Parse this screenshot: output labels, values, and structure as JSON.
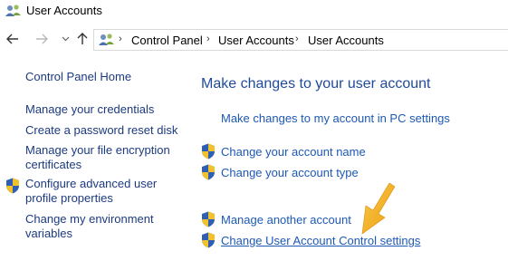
{
  "window": {
    "title": "User Accounts"
  },
  "address_bar": {
    "breadcrumbs": [
      "Control Panel",
      "User Accounts",
      "User Accounts"
    ]
  },
  "left_nav": {
    "home": "Control Panel Home",
    "items": [
      {
        "label": "Manage your credentials"
      },
      {
        "label": "Create a password reset disk"
      },
      {
        "label_line1": "Manage your file encryption",
        "label_line2": "certificates"
      },
      {
        "label_line1": "Configure advanced user",
        "label_line2": "profile properties",
        "icon": "uac-shield-icon"
      },
      {
        "label_line1": "Change my environment",
        "label_line2": "variables"
      }
    ]
  },
  "main": {
    "title": "Make changes to your user account",
    "pc_settings_link": "Make changes to my account in PC settings",
    "links": [
      {
        "label": "Change your account name",
        "icon": "uac-shield-icon"
      },
      {
        "label": "Change your account type",
        "icon": "uac-shield-icon"
      },
      {
        "label": "Manage another account",
        "icon": "uac-shield-icon"
      },
      {
        "label": "Change User Account Control settings",
        "icon": "uac-shield-icon"
      }
    ]
  },
  "colors": {
    "link": "#1d58b5",
    "nav_link": "#1c3a80",
    "title": "#1e4b9b",
    "arrow": "#f5b21a"
  }
}
